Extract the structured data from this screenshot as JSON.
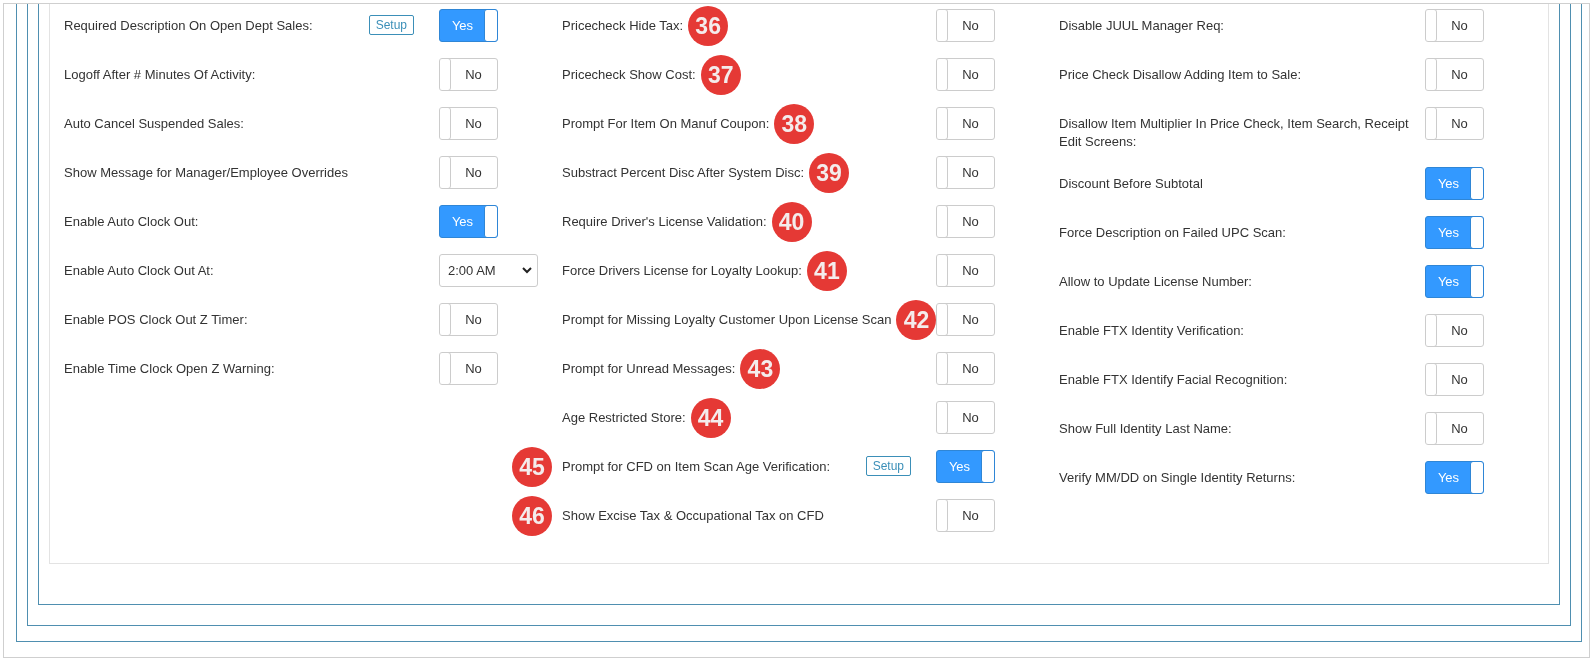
{
  "columns": [
    {
      "rows": [
        {
          "label": "Required Description On Open Dept Sales:",
          "kind": "toggle",
          "setup": "Setup",
          "on": true,
          "value": "Yes"
        },
        {
          "label": "Logoff After # Minutes Of Activity:",
          "kind": "toggle",
          "on": false,
          "value": "No"
        },
        {
          "label": "Auto Cancel Suspended Sales:",
          "kind": "toggle",
          "on": false,
          "value": "No"
        },
        {
          "label": "Show Message for Manager/Employee Overrides",
          "kind": "toggle",
          "on": false,
          "value": "No"
        },
        {
          "label": "Enable Auto Clock Out:",
          "kind": "toggle",
          "on": true,
          "value": "Yes"
        },
        {
          "label": "Enable Auto Clock Out At:",
          "kind": "select",
          "value": "2:00 AM"
        },
        {
          "label": "Enable POS Clock Out Z Timer:",
          "kind": "toggle",
          "on": false,
          "value": "No"
        },
        {
          "label": "Enable Time Clock Open Z Warning:",
          "kind": "toggle",
          "on": false,
          "value": "No"
        }
      ]
    },
    {
      "rows": [
        {
          "label": "Pricecheck Hide Tax:",
          "kind": "toggle",
          "on": false,
          "value": "No",
          "badge": {
            "text": "36",
            "before_label": false
          }
        },
        {
          "label": "Pricecheck Show Cost:",
          "kind": "toggle",
          "on": false,
          "value": "No",
          "badge": {
            "text": "37",
            "before_label": false
          }
        },
        {
          "label": "Prompt For Item On Manuf Coupon:",
          "kind": "toggle",
          "on": false,
          "value": "No",
          "badge": {
            "text": "38",
            "before_label": false
          }
        },
        {
          "label": "Substract Percent Disc After System Disc:",
          "kind": "toggle",
          "on": false,
          "value": "No",
          "badge": {
            "text": "39",
            "before_label": false
          }
        },
        {
          "label": "Require Driver's License Validation:",
          "kind": "toggle",
          "on": false,
          "value": "No",
          "badge": {
            "text": "40",
            "before_label": false
          }
        },
        {
          "label": "Force Drivers License for Loyalty Lookup:",
          "kind": "toggle",
          "on": false,
          "value": "No",
          "badge": {
            "text": "41",
            "before_label": false
          }
        },
        {
          "label": "Prompt for Missing Loyalty Customer Upon License Scan",
          "kind": "toggle",
          "on": false,
          "value": "No",
          "badge": {
            "text": "42",
            "before_label": false
          }
        },
        {
          "label": "Prompt for Unread Messages:",
          "kind": "toggle",
          "on": false,
          "value": "No",
          "badge": {
            "text": "43",
            "before_label": false
          }
        },
        {
          "label": "Age Restricted Store:",
          "kind": "toggle",
          "on": false,
          "value": "No",
          "badge": {
            "text": "44",
            "before_label": false
          }
        },
        {
          "label": "Prompt for CFD on Item Scan Age Verification:",
          "kind": "toggle",
          "setup": "Setup",
          "on": true,
          "value": "Yes",
          "badge": {
            "text": "45",
            "before_label": true
          }
        },
        {
          "label": "Show Excise Tax & Occupational Tax on CFD",
          "kind": "toggle",
          "on": false,
          "value": "No",
          "badge": {
            "text": "46",
            "before_label": true
          }
        }
      ]
    },
    {
      "rows": [
        {
          "label": "Disable JUUL Manager Req:",
          "kind": "toggle",
          "on": false,
          "value": "No"
        },
        {
          "label": "Price Check Disallow Adding Item to Sale:",
          "kind": "toggle",
          "on": false,
          "value": "No"
        },
        {
          "label": "Disallow Item Multiplier In Price Check, Item Search, Receipt Edit Screens:",
          "kind": "toggle",
          "on": false,
          "value": "No"
        },
        {
          "label": "Discount Before Subtotal",
          "kind": "toggle",
          "on": true,
          "value": "Yes"
        },
        {
          "label": "Force Description on Failed UPC Scan:",
          "kind": "toggle",
          "on": true,
          "value": "Yes"
        },
        {
          "label": "Allow to Update License Number:",
          "kind": "toggle",
          "on": true,
          "value": "Yes"
        },
        {
          "label": "Enable FTX Identity Verification:",
          "kind": "toggle",
          "on": false,
          "value": "No"
        },
        {
          "label": "Enable FTX Identify Facial Recognition:",
          "kind": "toggle",
          "on": false,
          "value": "No"
        },
        {
          "label": "Show Full Identity Last Name:",
          "kind": "toggle",
          "on": false,
          "value": "No"
        },
        {
          "label": "Verify MM/DD on Single Identity Returns:",
          "kind": "toggle",
          "on": true,
          "value": "Yes"
        }
      ]
    }
  ]
}
